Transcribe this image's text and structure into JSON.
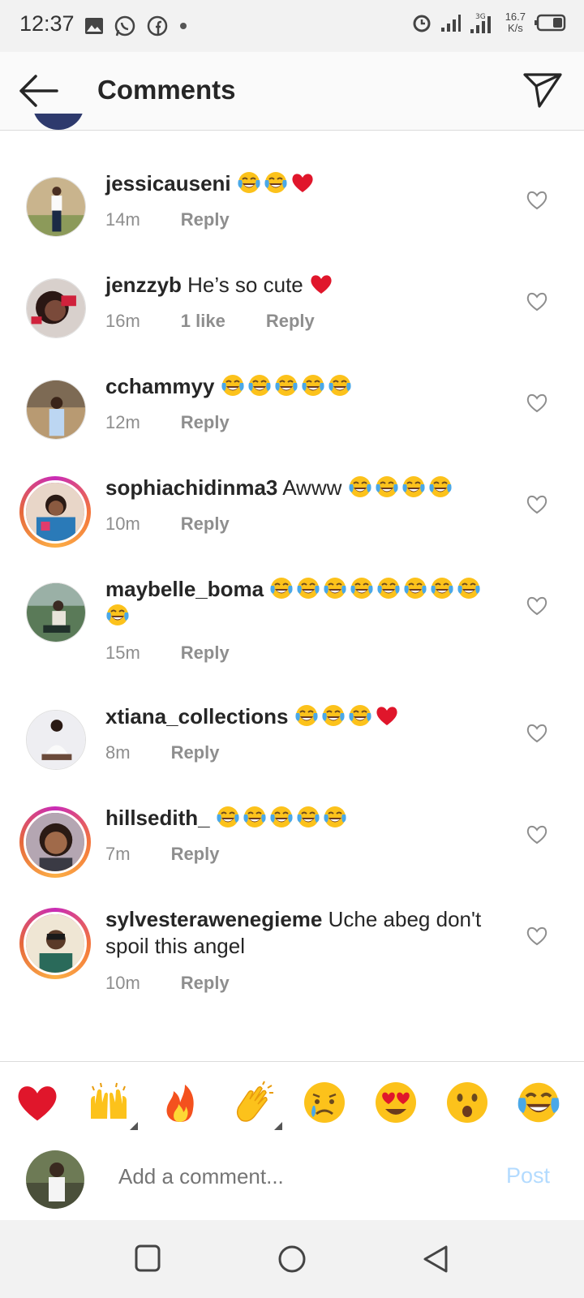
{
  "status_bar": {
    "time": "12:37",
    "network": "3G",
    "speed_value": "16.7",
    "speed_unit": "K/s",
    "icons_left": [
      "gallery-icon",
      "whatsapp-icon",
      "facebook-icon",
      "dot-icon"
    ],
    "icons_right": [
      "alarm-icon",
      "signal-icon",
      "signal-3g-icon",
      "battery-icon"
    ]
  },
  "header": {
    "title": "Comments",
    "back_icon": "back-arrow-icon",
    "share_icon": "direct-send-icon"
  },
  "comments": [
    {
      "username": "jessicauseni",
      "text": "",
      "emojis": [
        "joy",
        "joy",
        "heart"
      ],
      "time": "14m",
      "likes": "",
      "reply": "Reply",
      "ring": false
    },
    {
      "username": "jenzzyb",
      "text": "He’s so cute",
      "emojis": [
        "heart"
      ],
      "time": "16m",
      "likes": "1 like",
      "reply": "Reply",
      "ring": false
    },
    {
      "username": "cchammyy",
      "text": "",
      "emojis": [
        "joy",
        "joy",
        "joy",
        "joy",
        "joy"
      ],
      "time": "12m",
      "likes": "",
      "reply": "Reply",
      "ring": false
    },
    {
      "username": "sophiachidinma3",
      "text": "Awww",
      "emojis": [
        "joy",
        "joy",
        "joy",
        "joy"
      ],
      "time": "10m",
      "likes": "",
      "reply": "Reply",
      "ring": true
    },
    {
      "username": "maybelle_boma",
      "text": "",
      "emojis": [
        "joy",
        "joy",
        "joy",
        "joy",
        "joy",
        "joy",
        "joy",
        "joy",
        "joy"
      ],
      "time": "15m",
      "likes": "",
      "reply": "Reply",
      "ring": false
    },
    {
      "username": "xtiana_collections",
      "text": "",
      "emojis": [
        "joy",
        "joy",
        "joy",
        "heart"
      ],
      "time": "8m",
      "likes": "",
      "reply": "Reply",
      "ring": false
    },
    {
      "username": "hillsedith_",
      "text": "",
      "emojis": [
        "joy",
        "joy",
        "joy",
        "joy",
        "joy"
      ],
      "time": "7m",
      "likes": "",
      "reply": "Reply",
      "ring": true
    },
    {
      "username": "sylvesterawenegieme",
      "text": "Uche abeg don't spoil this angel",
      "emojis": [],
      "time": "10m",
      "likes": "",
      "reply": "Reply",
      "ring": true
    }
  ],
  "reactions": [
    "red-heart",
    "raising-hands",
    "fire",
    "clapping-hands",
    "crying-face",
    "heart-eyes",
    "surprised-face",
    "tears-of-joy"
  ],
  "composer": {
    "placeholder": "Add a comment...",
    "post_label": "Post"
  },
  "nav": [
    "recent-apps-icon",
    "home-icon",
    "back-icon"
  ],
  "colors": {
    "accent_post": "#b3dbff",
    "heart": "#e0162b",
    "muted": "#8e8e8e"
  }
}
